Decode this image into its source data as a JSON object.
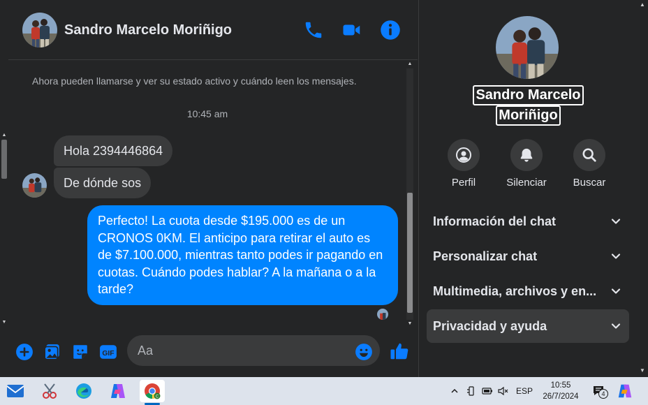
{
  "contact": {
    "name": "Sandro Marcelo Moriñigo",
    "name_line1": "Sandro Marcelo",
    "name_line2": "Moriñigo"
  },
  "header": {
    "icons": [
      "phone-icon",
      "video-call-icon",
      "info-icon"
    ]
  },
  "conversation": {
    "system_note": "Ahora pueden llamarse y ver su estado activo y cuándo leen los mensajes.",
    "timestamp": "10:45 am",
    "messages": [
      {
        "direction": "incoming",
        "text": "Hola 2394446864"
      },
      {
        "direction": "incoming",
        "text": "De dónde sos"
      },
      {
        "direction": "outgoing",
        "text": "Perfecto! La cuota desde $195.000 es de un CRONOS 0KM. El anticipo para retirar el auto es de $7.100.000, mientras tanto podes ir pagando en cuotas. Cuándo podes hablar? A la mañana o a la tarde?"
      }
    ]
  },
  "composer": {
    "placeholder": "Aa",
    "value": "",
    "icons": [
      "plus-icon",
      "photo-icon",
      "sticker-icon",
      "gif-icon",
      "emoji-icon",
      "like-icon"
    ]
  },
  "info_panel": {
    "actions": [
      {
        "label": "Perfil",
        "icon": "profile-icon"
      },
      {
        "label": "Silenciar",
        "icon": "bell-icon"
      },
      {
        "label": "Buscar",
        "icon": "search-icon"
      }
    ],
    "sections": [
      {
        "label": "Información del chat"
      },
      {
        "label": "Personalizar chat"
      },
      {
        "label": "Multimedia, archivos y en..."
      },
      {
        "label": "Privacidad y ayuda"
      }
    ]
  },
  "taskbar": {
    "apps": [
      "mail",
      "snipping-tool",
      "edge",
      "copilot",
      "chrome"
    ],
    "language": "ESP",
    "time": "10:55",
    "date": "26/7/2024",
    "notification_count": "4",
    "colors": {
      "accent": "#0084ff",
      "background": "#242526",
      "bubble": "#3a3b3c"
    }
  }
}
